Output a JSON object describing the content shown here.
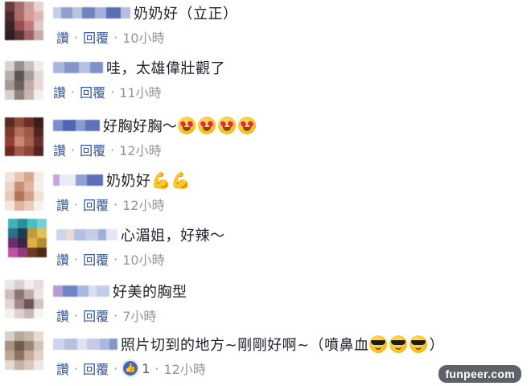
{
  "actions": {
    "like_label": "讚",
    "reply_label": "回覆",
    "separator": "·"
  },
  "comments": [
    {
      "text": "奶奶好（立正）",
      "emoji": [],
      "time": "10小時",
      "likes": null
    },
    {
      "text": "哇，太雄偉壯觀了",
      "emoji": [],
      "time": "11小時",
      "likes": null
    },
    {
      "text": "好胸好胸～",
      "emoji": [
        "heart-eyes-emoji",
        "heart-eyes-emoji",
        "heart-eyes-emoji",
        "heart-eyes-emoji"
      ],
      "time": "12小時",
      "likes": null
    },
    {
      "text": "奶奶好",
      "emoji": [
        "flexed-biceps-emoji",
        "flexed-biceps-emoji"
      ],
      "time": "12小時",
      "likes": null
    },
    {
      "text": "心湄姐，好辣～",
      "emoji": [],
      "time": "10小時",
      "likes": null
    },
    {
      "text": "好美的胸型",
      "emoji": [],
      "time": "7小時",
      "likes": null
    },
    {
      "text": "照片切到的地方~剛剛好啊~（噴鼻血",
      "text_suffix": "）",
      "emoji": [
        "sunglasses-emoji",
        "sunglasses-emoji",
        "sunglasses-emoji"
      ],
      "time": "12小時",
      "likes": "1"
    }
  ],
  "watermark": "funpeer.com",
  "colors": {
    "link": "#365899",
    "meta": "#90949c",
    "text": "#1d2129",
    "like_badge": "#4267b2"
  }
}
